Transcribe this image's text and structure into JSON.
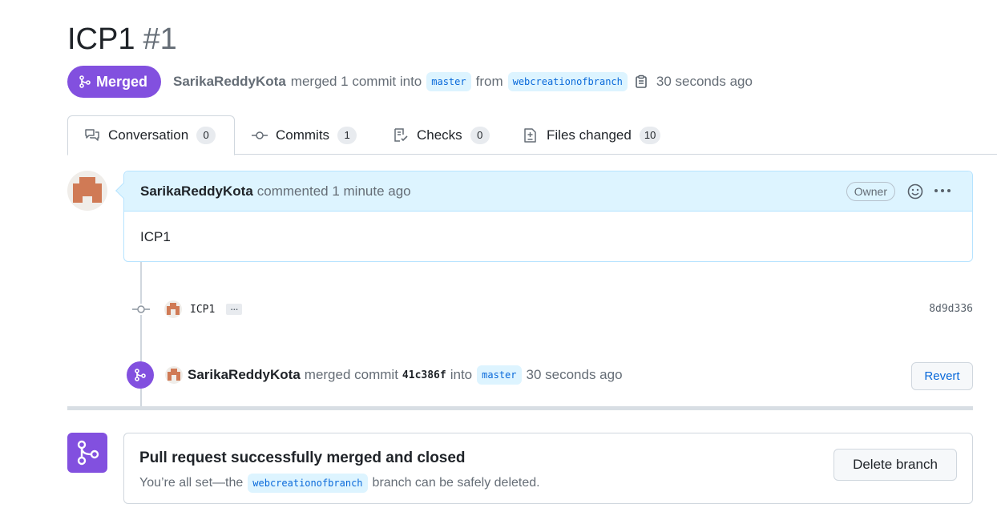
{
  "pr": {
    "title": "ICP1",
    "number": "#1",
    "state": "Merged",
    "author": "SarikaReddyKota",
    "merged_text": "merged 1 commit into",
    "base_branch": "master",
    "from_text": "from",
    "head_branch": "webcreationofbranch",
    "time": "30 seconds ago"
  },
  "tabs": [
    {
      "label": "Conversation",
      "count": "0",
      "icon": "comment-discussion-icon"
    },
    {
      "label": "Commits",
      "count": "1",
      "icon": "git-commit-icon"
    },
    {
      "label": "Checks",
      "count": "0",
      "icon": "checklist-icon"
    },
    {
      "label": "Files changed",
      "count": "10",
      "icon": "file-diff-icon"
    }
  ],
  "comment": {
    "author": "SarikaReddyKota",
    "meta": "commented 1 minute ago",
    "role": "Owner",
    "body": "ICP1"
  },
  "commit": {
    "message": "ICP1",
    "ellipsis": "…",
    "sha": "8d9d336"
  },
  "merge_event": {
    "author": "SarikaReddyKota",
    "text1": "merged commit",
    "sha": "41c386f",
    "text2": "into",
    "branch": "master",
    "time": "30 seconds ago",
    "revert_label": "Revert"
  },
  "merge_box": {
    "title": "Pull request successfully merged and closed",
    "sub_prefix": "You’re all set—the",
    "branch": "webcreationofbranch",
    "sub_suffix": "branch can be safely deleted.",
    "delete_label": "Delete branch"
  },
  "colors": {
    "merged_purple": "#8250df",
    "link_blue": "#0969da",
    "avatar_orange": "#d07a55"
  }
}
